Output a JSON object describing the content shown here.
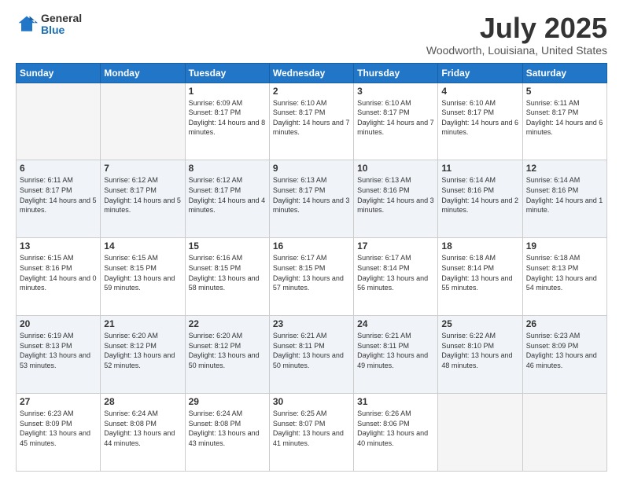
{
  "logo": {
    "general": "General",
    "blue": "Blue"
  },
  "header": {
    "title": "July 2025",
    "subtitle": "Woodworth, Louisiana, United States"
  },
  "days_of_week": [
    "Sunday",
    "Monday",
    "Tuesday",
    "Wednesday",
    "Thursday",
    "Friday",
    "Saturday"
  ],
  "weeks": [
    [
      {
        "day": "",
        "empty": true
      },
      {
        "day": "",
        "empty": true
      },
      {
        "day": "1",
        "sunrise": "Sunrise: 6:09 AM",
        "sunset": "Sunset: 8:17 PM",
        "daylight": "Daylight: 14 hours and 8 minutes."
      },
      {
        "day": "2",
        "sunrise": "Sunrise: 6:10 AM",
        "sunset": "Sunset: 8:17 PM",
        "daylight": "Daylight: 14 hours and 7 minutes."
      },
      {
        "day": "3",
        "sunrise": "Sunrise: 6:10 AM",
        "sunset": "Sunset: 8:17 PM",
        "daylight": "Daylight: 14 hours and 7 minutes."
      },
      {
        "day": "4",
        "sunrise": "Sunrise: 6:10 AM",
        "sunset": "Sunset: 8:17 PM",
        "daylight": "Daylight: 14 hours and 6 minutes."
      },
      {
        "day": "5",
        "sunrise": "Sunrise: 6:11 AM",
        "sunset": "Sunset: 8:17 PM",
        "daylight": "Daylight: 14 hours and 6 minutes."
      }
    ],
    [
      {
        "day": "6",
        "sunrise": "Sunrise: 6:11 AM",
        "sunset": "Sunset: 8:17 PM",
        "daylight": "Daylight: 14 hours and 5 minutes."
      },
      {
        "day": "7",
        "sunrise": "Sunrise: 6:12 AM",
        "sunset": "Sunset: 8:17 PM",
        "daylight": "Daylight: 14 hours and 5 minutes."
      },
      {
        "day": "8",
        "sunrise": "Sunrise: 6:12 AM",
        "sunset": "Sunset: 8:17 PM",
        "daylight": "Daylight: 14 hours and 4 minutes."
      },
      {
        "day": "9",
        "sunrise": "Sunrise: 6:13 AM",
        "sunset": "Sunset: 8:17 PM",
        "daylight": "Daylight: 14 hours and 3 minutes."
      },
      {
        "day": "10",
        "sunrise": "Sunrise: 6:13 AM",
        "sunset": "Sunset: 8:16 PM",
        "daylight": "Daylight: 14 hours and 3 minutes."
      },
      {
        "day": "11",
        "sunrise": "Sunrise: 6:14 AM",
        "sunset": "Sunset: 8:16 PM",
        "daylight": "Daylight: 14 hours and 2 minutes."
      },
      {
        "day": "12",
        "sunrise": "Sunrise: 6:14 AM",
        "sunset": "Sunset: 8:16 PM",
        "daylight": "Daylight: 14 hours and 1 minute."
      }
    ],
    [
      {
        "day": "13",
        "sunrise": "Sunrise: 6:15 AM",
        "sunset": "Sunset: 8:16 PM",
        "daylight": "Daylight: 14 hours and 0 minutes."
      },
      {
        "day": "14",
        "sunrise": "Sunrise: 6:15 AM",
        "sunset": "Sunset: 8:15 PM",
        "daylight": "Daylight: 13 hours and 59 minutes."
      },
      {
        "day": "15",
        "sunrise": "Sunrise: 6:16 AM",
        "sunset": "Sunset: 8:15 PM",
        "daylight": "Daylight: 13 hours and 58 minutes."
      },
      {
        "day": "16",
        "sunrise": "Sunrise: 6:17 AM",
        "sunset": "Sunset: 8:15 PM",
        "daylight": "Daylight: 13 hours and 57 minutes."
      },
      {
        "day": "17",
        "sunrise": "Sunrise: 6:17 AM",
        "sunset": "Sunset: 8:14 PM",
        "daylight": "Daylight: 13 hours and 56 minutes."
      },
      {
        "day": "18",
        "sunrise": "Sunrise: 6:18 AM",
        "sunset": "Sunset: 8:14 PM",
        "daylight": "Daylight: 13 hours and 55 minutes."
      },
      {
        "day": "19",
        "sunrise": "Sunrise: 6:18 AM",
        "sunset": "Sunset: 8:13 PM",
        "daylight": "Daylight: 13 hours and 54 minutes."
      }
    ],
    [
      {
        "day": "20",
        "sunrise": "Sunrise: 6:19 AM",
        "sunset": "Sunset: 8:13 PM",
        "daylight": "Daylight: 13 hours and 53 minutes."
      },
      {
        "day": "21",
        "sunrise": "Sunrise: 6:20 AM",
        "sunset": "Sunset: 8:12 PM",
        "daylight": "Daylight: 13 hours and 52 minutes."
      },
      {
        "day": "22",
        "sunrise": "Sunrise: 6:20 AM",
        "sunset": "Sunset: 8:12 PM",
        "daylight": "Daylight: 13 hours and 50 minutes."
      },
      {
        "day": "23",
        "sunrise": "Sunrise: 6:21 AM",
        "sunset": "Sunset: 8:11 PM",
        "daylight": "Daylight: 13 hours and 50 minutes."
      },
      {
        "day": "24",
        "sunrise": "Sunrise: 6:21 AM",
        "sunset": "Sunset: 8:11 PM",
        "daylight": "Daylight: 13 hours and 49 minutes."
      },
      {
        "day": "25",
        "sunrise": "Sunrise: 6:22 AM",
        "sunset": "Sunset: 8:10 PM",
        "daylight": "Daylight: 13 hours and 48 minutes."
      },
      {
        "day": "26",
        "sunrise": "Sunrise: 6:23 AM",
        "sunset": "Sunset: 8:09 PM",
        "daylight": "Daylight: 13 hours and 46 minutes."
      }
    ],
    [
      {
        "day": "27",
        "sunrise": "Sunrise: 6:23 AM",
        "sunset": "Sunset: 8:09 PM",
        "daylight": "Daylight: 13 hours and 45 minutes."
      },
      {
        "day": "28",
        "sunrise": "Sunrise: 6:24 AM",
        "sunset": "Sunset: 8:08 PM",
        "daylight": "Daylight: 13 hours and 44 minutes."
      },
      {
        "day": "29",
        "sunrise": "Sunrise: 6:24 AM",
        "sunset": "Sunset: 8:08 PM",
        "daylight": "Daylight: 13 hours and 43 minutes."
      },
      {
        "day": "30",
        "sunrise": "Sunrise: 6:25 AM",
        "sunset": "Sunset: 8:07 PM",
        "daylight": "Daylight: 13 hours and 41 minutes."
      },
      {
        "day": "31",
        "sunrise": "Sunrise: 6:26 AM",
        "sunset": "Sunset: 8:06 PM",
        "daylight": "Daylight: 13 hours and 40 minutes."
      },
      {
        "day": "",
        "empty": true
      },
      {
        "day": "",
        "empty": true
      }
    ]
  ]
}
